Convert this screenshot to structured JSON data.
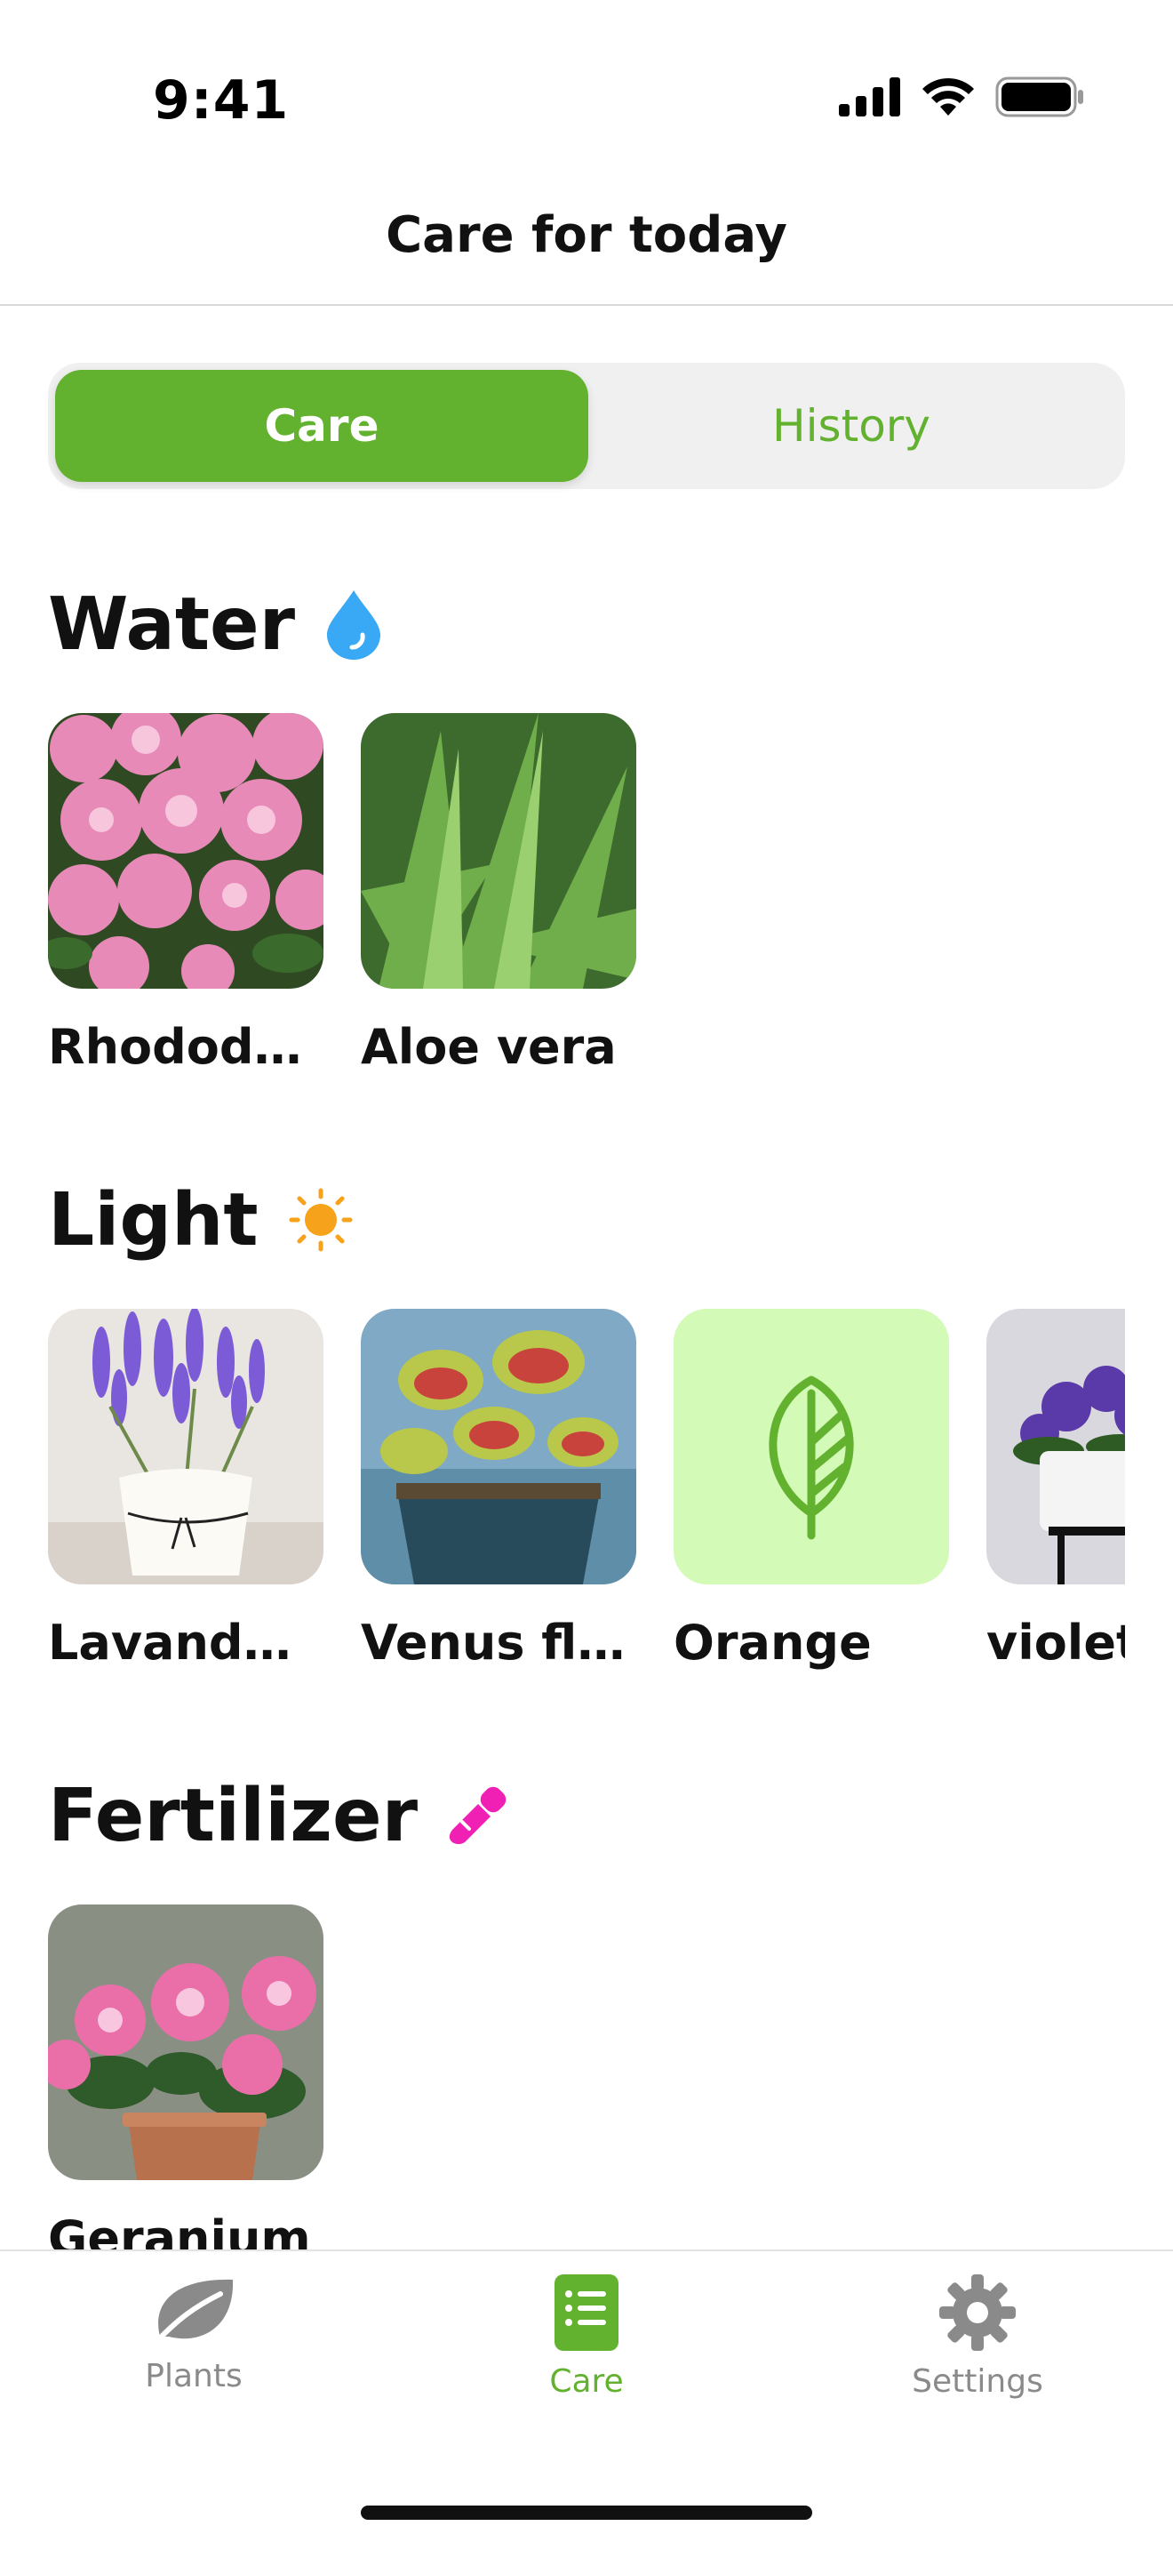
{
  "status_bar": {
    "time": "9:41"
  },
  "nav": {
    "title": "Care for today"
  },
  "segmented": {
    "active_label": "Care",
    "inactive_label": "History"
  },
  "sections": {
    "water": {
      "title": "Water",
      "icon": "water-drop-icon",
      "icon_color": "#3aa9f5",
      "plants": [
        {
          "name": "Rhododen..."
        },
        {
          "name": "Aloe vera"
        }
      ]
    },
    "light": {
      "title": "Light",
      "icon": "sun-icon",
      "icon_color": "#f7a21b",
      "plants": [
        {
          "name": "Lavandulla"
        },
        {
          "name": "Venus flyt..."
        },
        {
          "name": "Orange"
        },
        {
          "name": "violet"
        }
      ]
    },
    "fertilizer": {
      "title": "Fertilizer",
      "icon": "pipette-icon",
      "icon_color": "#f020b4",
      "plants": [
        {
          "name": "Geranium"
        }
      ]
    }
  },
  "tabbar": {
    "plants": "Plants",
    "care": "Care",
    "settings": "Settings"
  },
  "colors": {
    "accent": "#63b22f",
    "placeholder_bg": "#d3fbb7",
    "inactive_tab": "#8a8a8a"
  }
}
